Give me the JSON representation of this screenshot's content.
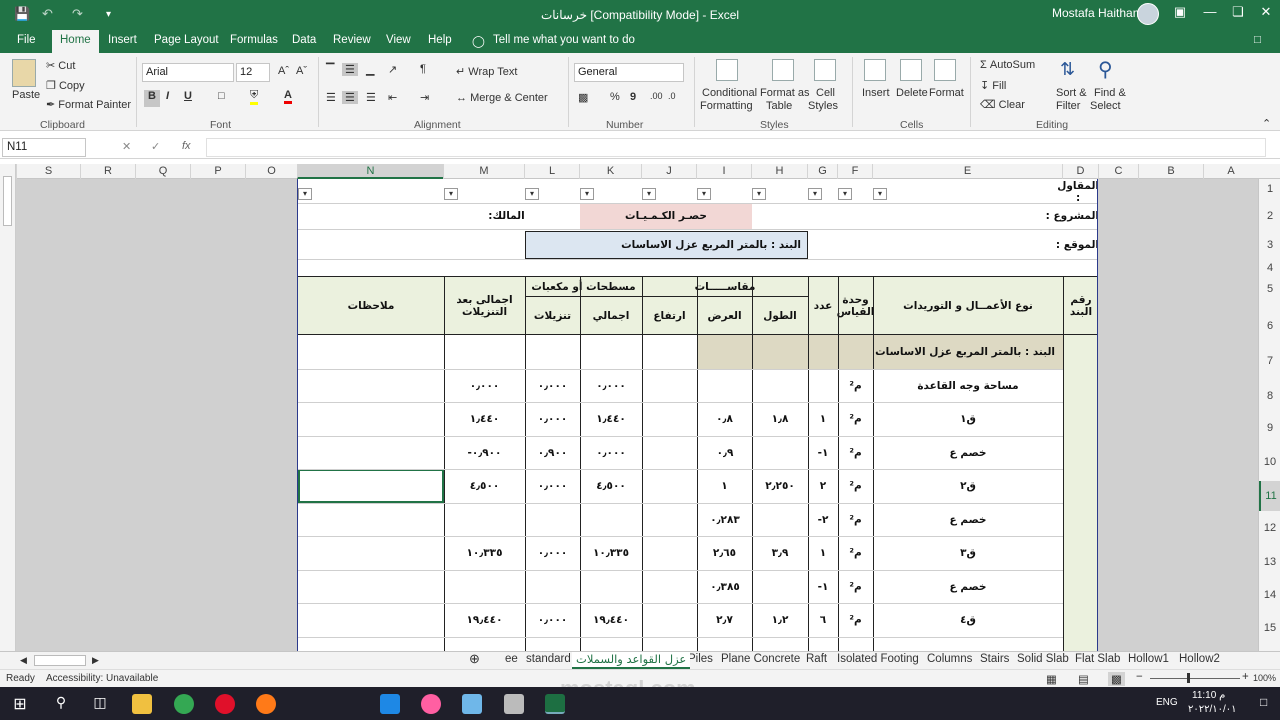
{
  "window": {
    "qa_save": "💾",
    "qa_undo": "↶",
    "qa_redo": "↷",
    "qa_more": "▾",
    "title": "خرسانات  [Compatibility Mode]  -  Excel",
    "user": "Mostafa Haitham",
    "minimize": "—",
    "restore": "❏",
    "close": "✕",
    "ribbon_opts": "▣"
  },
  "tabs": [
    "File",
    "Home",
    "Insert",
    "Page Layout",
    "Formulas",
    "Data",
    "Review",
    "View",
    "Help"
  ],
  "tellme": "Tell me what you want to do",
  "clipboard": {
    "paste": "Paste",
    "cut": "Cut",
    "copy": "Copy",
    "painter": "Format Painter",
    "group": "Clipboard"
  },
  "font": {
    "name": "Arial",
    "size": "12",
    "bold": "B",
    "italic": "I",
    "underline": "U",
    "group": "Font"
  },
  "alignment": {
    "wrap": "Wrap Text",
    "merge": "Merge & Center",
    "group": "Alignment"
  },
  "number": {
    "format": "General",
    "percent": "%",
    "comma": "9",
    "group": "Number"
  },
  "styles": {
    "conditional": "Conditional",
    "conditional2": "Formatting",
    "format_as": "Format as",
    "format_as2": "Table",
    "cell": "Cell",
    "cell2": "Styles",
    "group": "Styles"
  },
  "cells": {
    "insert": "Insert",
    "delete": "Delete",
    "format": "Format",
    "group": "Cells"
  },
  "editing": {
    "autosum": "AutoSum",
    "fill": "Fill",
    "clear": "Clear",
    "sort": "Sort &",
    "sort2": "Filter",
    "find": "Find &",
    "find2": "Select",
    "group": "Editing"
  },
  "formula_bar": {
    "namebox": "N11",
    "fx": "fx",
    "cancel": "✕",
    "enter": "✓",
    "value": ""
  },
  "columns": [
    "S",
    "R",
    "Q",
    "P",
    "O",
    "N",
    "M",
    "L",
    "K",
    "J",
    "I",
    "H",
    "G",
    "F",
    "E",
    "D",
    "C",
    "B",
    "A"
  ],
  "rows": [
    "1",
    "2",
    "3",
    "4",
    "5",
    "6",
    "7",
    "8",
    "9",
    "10",
    "11",
    "12",
    "13",
    "14",
    "15"
  ],
  "sheet": {
    "contractor": "المقاول :",
    "project": "المشروع :",
    "location": "الموقع :",
    "owner": "المالك:",
    "quantities": "حصـر الكـمـيـات",
    "item_banner": "البند :  بالمتر المربع عزل الاساسات",
    "h_item_no": "رقم البند",
    "h_work_type": "نوع الأعمــال و التوريدات",
    "h_unit": "وحدة القياس",
    "h_count": "عدد",
    "h_dims": "مقاســـــات",
    "h_length": "الطول",
    "h_width": "العرض",
    "h_height": "ارتفاع",
    "h_areas": "مسطحات أو مكعبات",
    "h_total": "اجمالي",
    "h_deductions": "تنزيلات",
    "h_net": "اجمالى بعد التنزيلات",
    "h_notes": "ملاحظات",
    "section": "البند :  بالمتر المربع عزل الاساسات",
    "unit_m2": "م²",
    "data_rows": [
      {
        "desc": "مساحة وجه القاعدة",
        "count": "",
        "length": "",
        "width": "",
        "height": "",
        "total": "٠٫٠٠٠",
        "deduct": "٠٫٠٠٠",
        "net": "٠٫٠٠٠"
      },
      {
        "desc": "ق١",
        "count": "١",
        "length": "١٫٨",
        "width": "٠٫٨",
        "height": "",
        "total": "١٫٤٤٠",
        "deduct": "٠٫٠٠٠",
        "net": "١٫٤٤٠"
      },
      {
        "desc": "خصم ع",
        "count": "١-",
        "merged": "٠٫٩",
        "total": "٠٫٠٠٠",
        "deduct": "٠٫٩٠٠",
        "net": "٠٫٩٠٠-"
      },
      {
        "desc": "ق٢",
        "count": "٢",
        "length": "٢٫٢٥٠",
        "width": "١",
        "height": "",
        "total": "٤٫٥٠٠",
        "deduct": "٠٫٠٠٠",
        "net": "٤٫٥٠٠"
      },
      {
        "desc": "خصم ع",
        "count": "٢-",
        "merged": "٠٫٢٨٣",
        "total": "",
        "deduct": "",
        "net": ""
      },
      {
        "desc": "ق٣",
        "count": "١",
        "length": "٣٫٩",
        "width": "٢٫٦٥",
        "height": "",
        "total": "١٠٫٣٣٥",
        "deduct": "٠٫٠٠٠",
        "net": "١٠٫٣٣٥"
      },
      {
        "desc": "خصم ع",
        "count": "١-",
        "merged": "٠٫٣٨٥",
        "total": "",
        "deduct": "",
        "net": ""
      },
      {
        "desc": "ق٤",
        "count": "٦",
        "length": "١٫٢",
        "width": "٢٫٧",
        "height": "",
        "total": "١٩٫٤٤٠",
        "deduct": "٠٫٠٠٠",
        "net": "١٩٫٤٤٠"
      }
    ]
  },
  "sheet_tabs": [
    "Hollow2",
    "Hollow1",
    "Flat Slab",
    "Solid Slab",
    "Stairs",
    "Columns",
    "Isolated Footing",
    "Raft",
    "Plane Concrete",
    "Piles",
    "عزل القواعد والسملات",
    "standard",
    "ee"
  ],
  "active_sheet_index": 10,
  "status": {
    "ready": "Ready",
    "accessibility": "Accessibility: Unavailable",
    "zoom": "100%"
  },
  "watermark": "mostaql.com",
  "taskbar": {
    "time": "11:10 م",
    "date": "٢٠٢٢/١٠/٠١",
    "lang": "ENG"
  },
  "colors": {
    "excel_green": "#217346",
    "pink_fill": "#f2d7d5",
    "blue_fill": "#dce6f1",
    "tan_fill": "#ddd9c3",
    "green_fill": "#ebf1de"
  }
}
